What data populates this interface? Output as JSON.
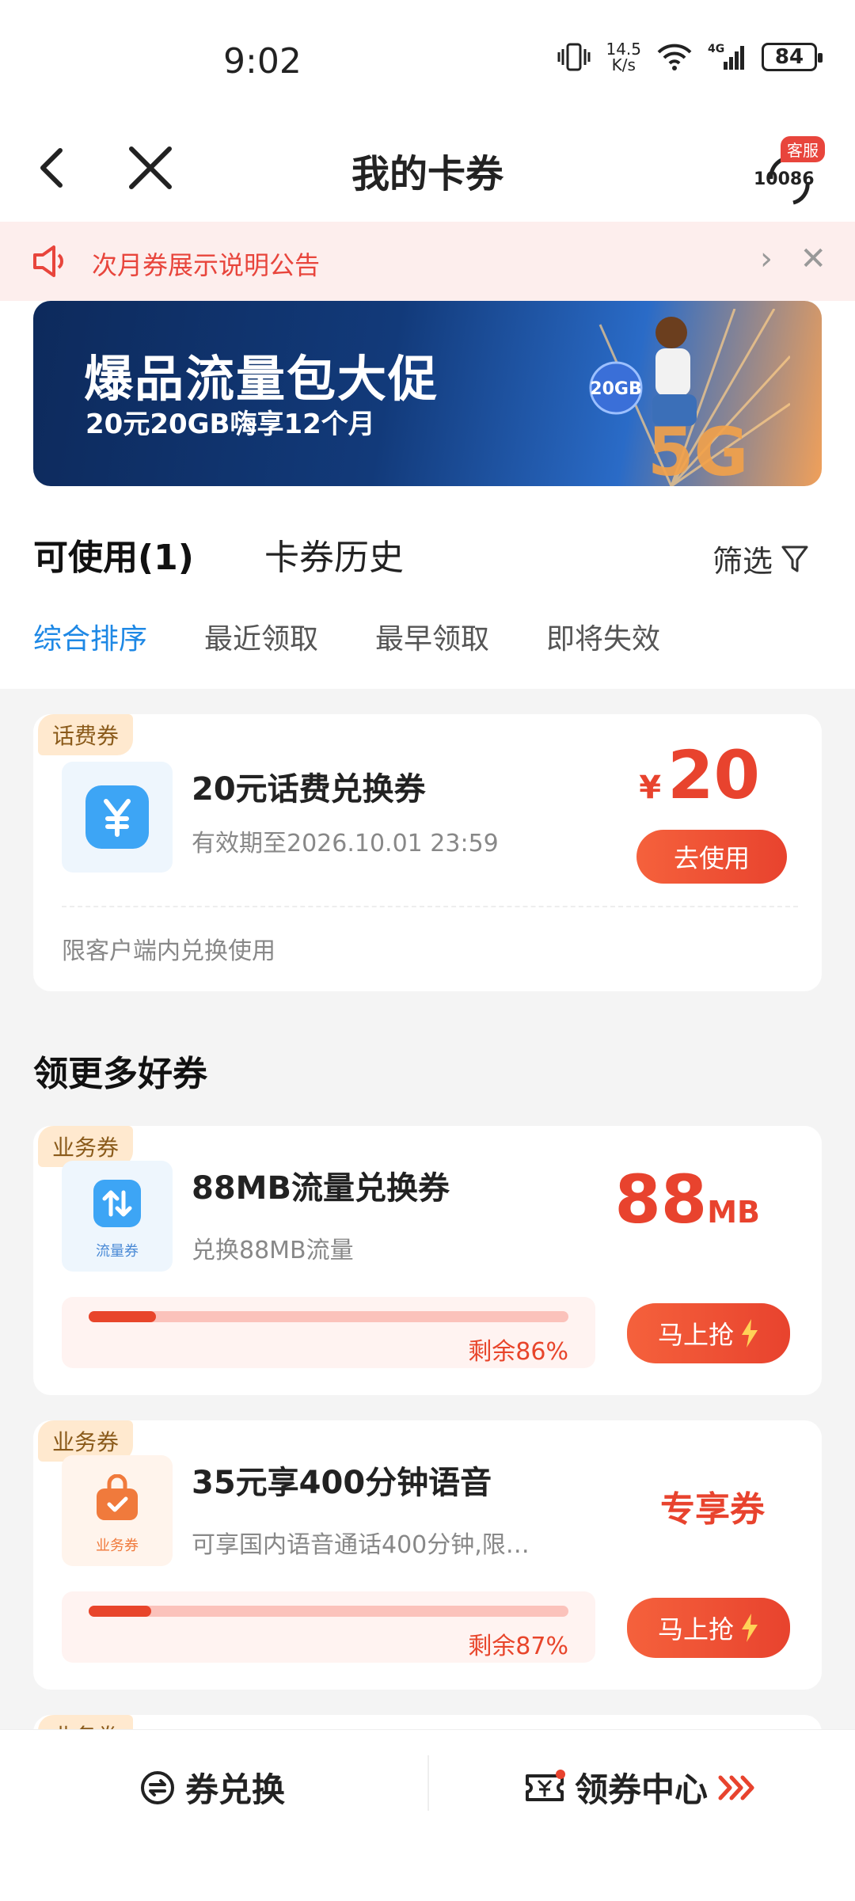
{
  "status_bar": {
    "time": "9:02",
    "speed_value": "14.5",
    "speed_unit": "K/s",
    "battery": "84"
  },
  "header": {
    "title": "我的卡券",
    "cs_badge": "客服",
    "cs_number": "10086"
  },
  "notice": {
    "text": "次月券展示说明公告"
  },
  "banner": {
    "title": "爆品流量包大促",
    "subtitle": "20元20GB嗨享12个月",
    "badge": "20GB"
  },
  "tabs": {
    "available": "可使用(1)",
    "history": "卡券历史",
    "filter": "筛选"
  },
  "sorts": [
    "综合排序",
    "最近领取",
    "最早领取",
    "即将失效"
  ],
  "active_sort_index": 0,
  "my_coupons": [
    {
      "tag": "话费券",
      "title": "20元话费兑换券",
      "expiry": "有效期至2026.10.01 23:59",
      "currency": "¥",
      "amount": "20",
      "button": "去使用",
      "note": "限客户端内兑换使用"
    }
  ],
  "more_section_title": "领更多好券",
  "more_coupons": [
    {
      "tag": "业务券",
      "thumb_label": "流量券",
      "title": "88MB流量兑换券",
      "desc": "兑换88MB流量",
      "value": "88",
      "unit": "MB",
      "remaining_label": "剩余86%",
      "progress_used": 0.14,
      "button": "马上抢"
    },
    {
      "tag": "业务券",
      "thumb_label": "业务券",
      "title": "35元享400分钟语音",
      "desc": "可享国内语音通话400分钟,限…",
      "value_text": "专享券",
      "remaining_label": "剩余87%",
      "progress_used": 0.13,
      "button": "马上抢"
    }
  ],
  "partial_tag": "业务券",
  "bottom_bar": {
    "exchange": "券兑换",
    "center": "领券中心"
  },
  "colors": {
    "accent_red": "#e8432e",
    "active_blue": "#1e88e5",
    "notice_bg": "#fdeeed"
  }
}
